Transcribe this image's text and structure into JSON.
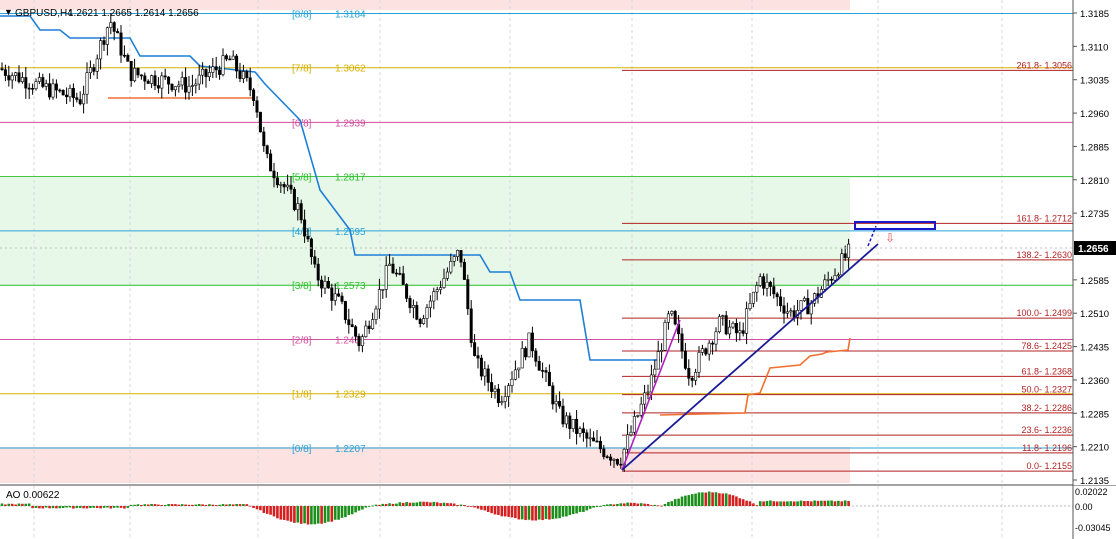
{
  "symbol_header": {
    "symbol": "GBPUSD,H4",
    "ohlc": "1.2621 1.2665 1.2614 1.2656"
  },
  "price_axis": {
    "ticks": [
      "1.3185",
      "1.3110",
      "1.3035",
      "1.2960",
      "1.2885",
      "1.2810",
      "1.2735",
      "1.2656",
      "1.2585",
      "1.2510",
      "1.2435",
      "1.2360",
      "1.2285",
      "1.2210",
      "1.2135"
    ],
    "current_price": "1.2656"
  },
  "murrey_levels": [
    {
      "label": "[8/8]",
      "value": "1.3184",
      "color": "#29a3d6"
    },
    {
      "label": "[7/8]",
      "value": "1.3062",
      "color": "#d4b000"
    },
    {
      "label": "[6/8]",
      "value": "1.2939",
      "color": "#d050a0"
    },
    {
      "label": "[5/8]",
      "value": "1.2817",
      "color": "#2cc02c"
    },
    {
      "label": "[4/8]",
      "value": "1.2695",
      "color": "#29a3d6"
    },
    {
      "label": "[3/8]",
      "value": "1.2573",
      "color": "#2cc02c"
    },
    {
      "label": "[2/8]",
      "value": "1.2451",
      "color": "#d050a0"
    },
    {
      "label": "[1/8]",
      "value": "1.2329",
      "color": "#d4b000"
    },
    {
      "label": "[0/8]",
      "value": "1.2207",
      "color": "#29a3d6"
    }
  ],
  "fib_levels": [
    {
      "label": "261.8- 1.3056"
    },
    {
      "label": "161.8- 1.2712"
    },
    {
      "label": "138.2- 1.2630"
    },
    {
      "label": "100.0- 1.2499"
    },
    {
      "label": "78.6- 1.2425"
    },
    {
      "label": "61.8- 1.2368"
    },
    {
      "label": "50.0- 1.2327"
    },
    {
      "label": "38.2- 1.2286"
    },
    {
      "label": "23.6- 1.2236"
    },
    {
      "label": "11.8- 1.2196"
    },
    {
      "label": "0.0- 1.2155"
    }
  ],
  "indicator": {
    "label": "AO 0.00622",
    "ticks": [
      "0.02022",
      "0.00",
      "-0.03045"
    ]
  },
  "colors": {
    "up_bar": "#1a8f1a",
    "down_bar": "#d62020",
    "fib_line": "#b22222",
    "channel_line": "#1e7fd8",
    "trendline": "#1a1a99",
    "impulse": "#b020c0",
    "trail_stop": "#f07030"
  }
}
